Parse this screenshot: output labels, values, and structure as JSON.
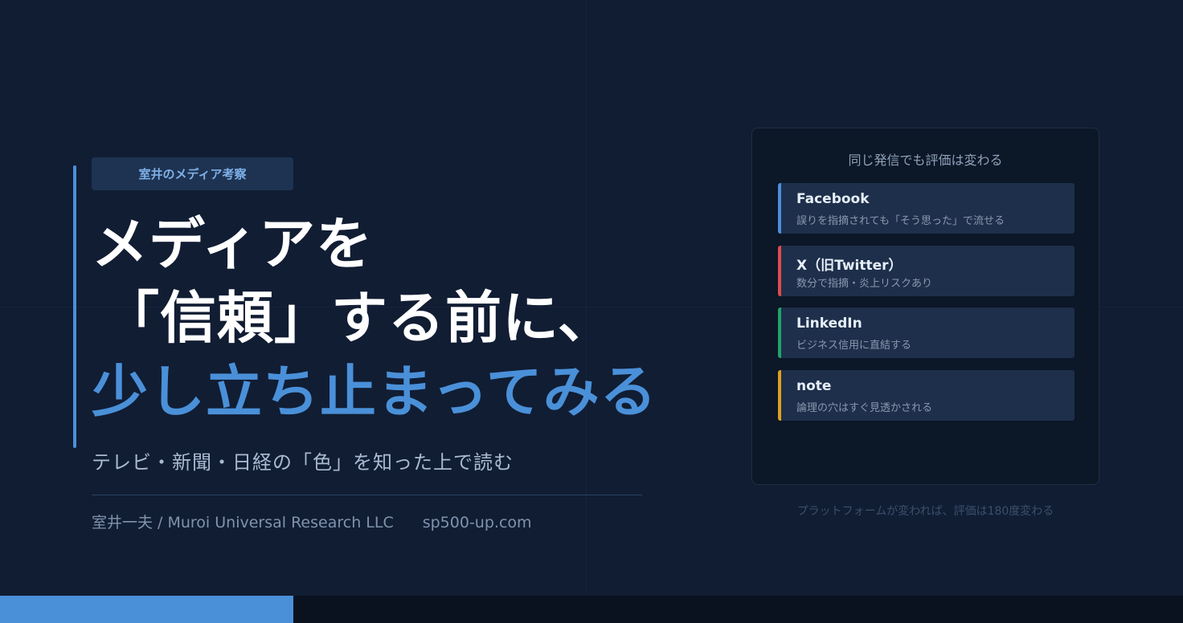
{
  "tag": "室井のメディア考察",
  "headline": {
    "line1": "メディアを",
    "line2": "「信頼」する前に、",
    "line3": "少し立ち止まってみる"
  },
  "subtitle": "テレビ・新聞・日経の「色」を知った上で読む",
  "footer": {
    "author": "室井一夫 / Muroi Universal Research LLC",
    "site": "sp500-up.com"
  },
  "card": {
    "title": "同じ発信でも評価は変わる",
    "platforms": [
      {
        "name": "Facebook",
        "desc": "誤りを指摘されても「そう思った」で流せる",
        "color": "#4a90d9"
      },
      {
        "name": "X（旧Twitter）",
        "desc": "数分で指摘・炎上リスクあり",
        "color": "#e04b4b"
      },
      {
        "name": "LinkedIn",
        "desc": "ビジネス信用に直結する",
        "color": "#1fa36b"
      },
      {
        "name": "note",
        "desc": "論理の穴はすぐ見透かされる",
        "color": "#e0a020"
      }
    ]
  },
  "caption": "プラットフォームが変われば、評価は180度変わる",
  "colors": {
    "background": "#111d33",
    "accent": "#4a90d9",
    "card_bg": "#0c1727"
  },
  "progress": 0.25
}
